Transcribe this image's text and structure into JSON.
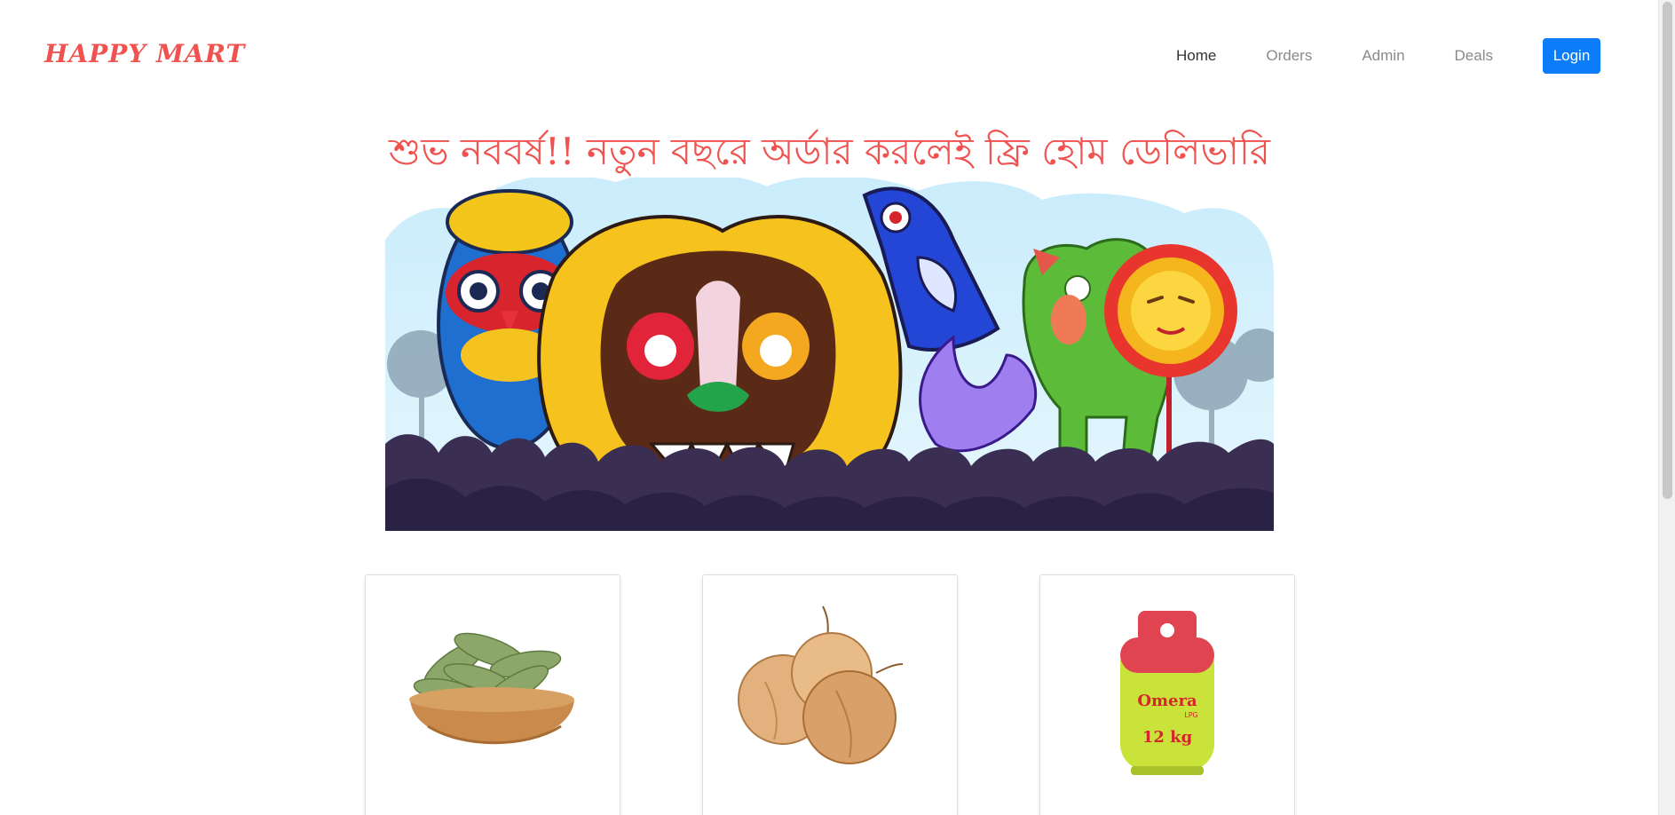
{
  "navbar": {
    "brand": "HAPPY MART",
    "links": [
      {
        "label": "Home",
        "active": true
      },
      {
        "label": "Orders",
        "active": false
      },
      {
        "label": "Admin",
        "active": false
      },
      {
        "label": "Deals",
        "active": false
      }
    ],
    "login_label": "Login"
  },
  "hero": {
    "headline": "শুভ নববর্ষ!! নতুন বছরে অর্ডার করলেই ফ্রি হোম ডেলিভারি",
    "banner_alt": "Pohela Boishakh festival masks illustration"
  },
  "products": [
    {
      "name": "",
      "image": "bay-leaves"
    },
    {
      "name": "",
      "image": "onions"
    },
    {
      "name": "",
      "image": "lpg-cylinder",
      "cylinder_brand": "Omera",
      "cylinder_type": "LPG",
      "cylinder_weight": "12 kg"
    }
  ],
  "colors": {
    "brand": "#f0524f",
    "primary": "#0b7dfa",
    "muted_link": "#8a8a8a"
  }
}
